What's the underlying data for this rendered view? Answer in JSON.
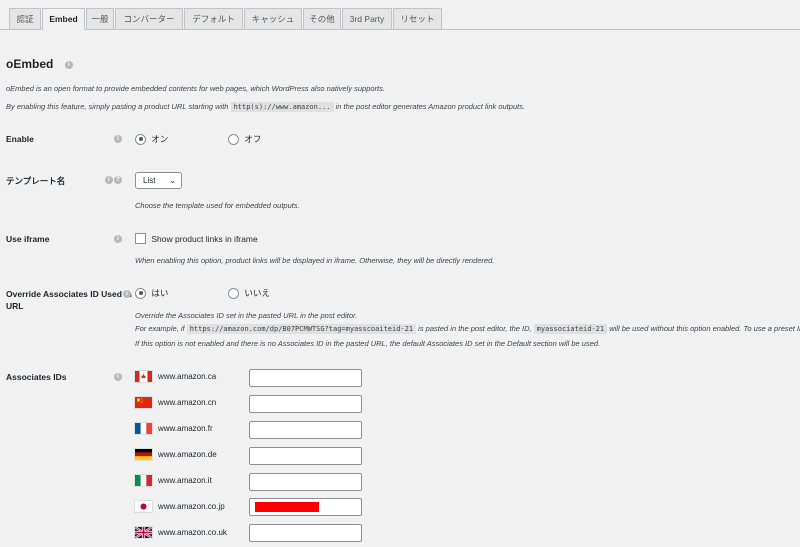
{
  "tabs": [
    {
      "label": "認証",
      "active": false
    },
    {
      "label": "Embed",
      "active": true
    },
    {
      "label": "一般",
      "active": false
    },
    {
      "label": "コンバーター",
      "active": false
    },
    {
      "label": "デフォルト",
      "active": false
    },
    {
      "label": "キャッシュ",
      "active": false
    },
    {
      "label": "その他",
      "active": false
    },
    {
      "label": "3rd Party",
      "active": false
    },
    {
      "label": "リセット",
      "active": false
    }
  ],
  "section": {
    "title": "oEmbed",
    "desc1": "oEmbed is an open format to provide embedded contents for web pages, which WordPress also natively supports.",
    "desc2_before": "By enabling this feature, simply pasting a product URL starting with",
    "desc2_code": "http(s)://www.amazon...",
    "desc2_after": "in the post editor generates Amazon product link outputs."
  },
  "enable": {
    "label": "Enable",
    "on": "オン",
    "off": "オフ",
    "selected": "on"
  },
  "template": {
    "label": "テンプレート名",
    "value": "List",
    "desc": "Choose the template used for embedded outputs."
  },
  "iframe": {
    "label": "Use iframe",
    "checkbox_label": "Show product links in iframe",
    "checked": false,
    "desc": "When enabling this option, product links will be displayed in iframe. Otherwise, they will be directly rendered."
  },
  "override": {
    "label_line1": "Override Associates ID Used in",
    "label_line2": "URL",
    "yes": "はい",
    "no": "いいえ",
    "selected": "yes",
    "desc1": "Override the Associates ID set in the pasted URL in the post editor.",
    "desc2_a": "For example, if",
    "desc2_code1": "https://amazon.com/dp/B07PCMWTSG?tag=myasscoaiteid-21",
    "desc2_b": "is pasted in the post editor, the ID,",
    "desc2_code2": "myassociateid-21",
    "desc2_c": "will be used without this option enabled. To use a preset ID",
    "desc3": "If this option is not enabled and there is no Associates ID in the pasted URL, the default Associates ID set in the Default section will be used."
  },
  "associates": {
    "label": "Associates IDs",
    "locales": [
      {
        "flag": "ca-flag",
        "domain": "www.amazon.ca",
        "value": ""
      },
      {
        "flag": "cn-flag",
        "domain": "www.amazon.cn",
        "value": ""
      },
      {
        "flag": "fr-flag",
        "domain": "www.amazon.fr",
        "value": ""
      },
      {
        "flag": "de-flag",
        "domain": "www.amazon.de",
        "value": ""
      },
      {
        "flag": "it-flag",
        "domain": "www.amazon.it",
        "value": ""
      },
      {
        "flag": "jp-flag",
        "domain": "www.amazon.co.jp",
        "value": "",
        "redacted": true
      },
      {
        "flag": "uk-flag",
        "domain": "www.amazon.co.uk",
        "value": ""
      }
    ]
  },
  "colors": {
    "redaction": "#ff0000",
    "info_icon": "#b8b8b8"
  }
}
